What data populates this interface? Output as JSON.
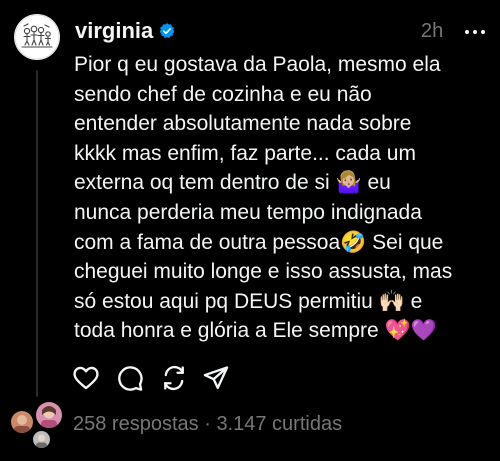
{
  "post": {
    "username": "virginia",
    "timestamp": "2h",
    "text": "Pior q eu gostava da Paola, mesmo ela\nsendo chef de cozinha e eu não\nentender absolutamente nada sobre\nkkkk mas enfim, faz parte... cada um\nexterna oq tem dentro de si 🤷🏼‍♀️ eu\nnunca perderia meu tempo indignada\ncom a fama de outra pessoa🤣 Sei que\ncheguei muito longe e isso assusta, mas\nsó estou aqui pq DEUS permitiu 🙌🏻 e\ntoda honra e glória a Ele sempre 💖💜",
    "replies_label": "258 respostas",
    "separator": "·",
    "likes_label": "3.147 curtidas"
  },
  "icons": {
    "verified": "verified-badge-icon",
    "more": "more-options-icon",
    "like": "heart-icon",
    "reply": "comment-icon",
    "repost": "repost-icon",
    "share": "send-icon"
  },
  "colors": {
    "background": "#000000",
    "text_primary": "#f3f5f7",
    "text_secondary": "#777777",
    "verified_blue": "#0095f6",
    "thread_line": "#2a2a2a"
  }
}
